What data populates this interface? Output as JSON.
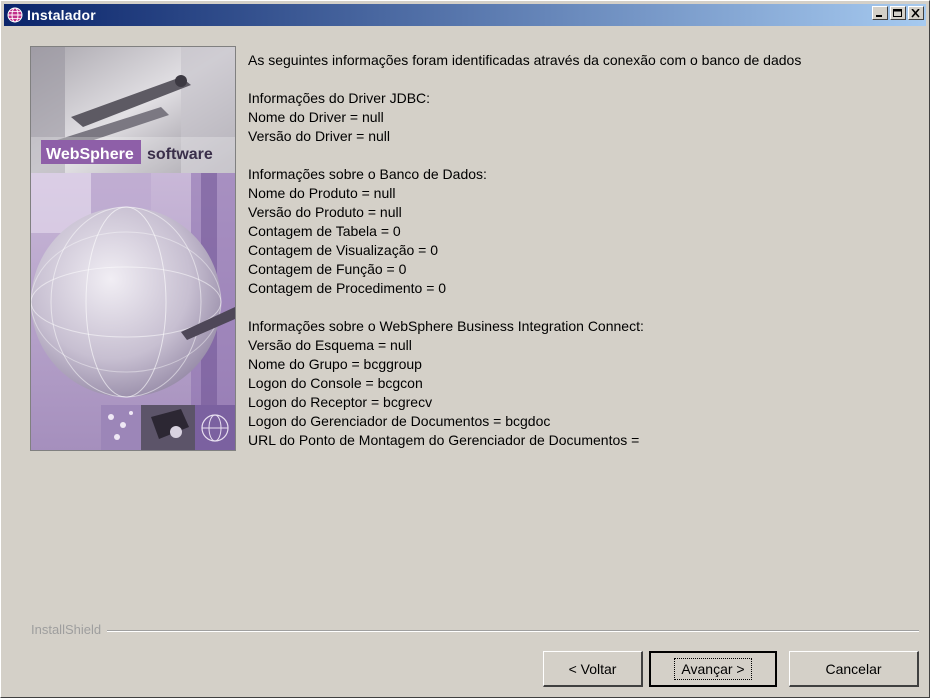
{
  "window": {
    "title": "Instalador"
  },
  "banner": {
    "brand": "WebSphere",
    "product": "software"
  },
  "content": {
    "intro": "As seguintes informações foram identificadas através da conexão com o banco de dados",
    "driver_section": {
      "heading": "Informações do Driver JDBC:",
      "lines": [
        "Nome do Driver = null",
        "Versão do Driver = null"
      ]
    },
    "db_section": {
      "heading": "Informações sobre o Banco de Dados:",
      "lines": [
        "Nome do Produto = null",
        "Versão do Produto = null",
        "Contagem de Tabela = 0",
        "Contagem de Visualização = 0",
        "Contagem de Função = 0",
        "Contagem de Procedimento = 0"
      ]
    },
    "wbi_section": {
      "heading": "Informações sobre o WebSphere Business Integration Connect:",
      "lines": [
        "Versão do Esquema = null",
        "Nome do Grupo = bcggroup",
        "Logon do Console = bcgcon",
        "Logon do Receptor = bcgrecv",
        "Logon do Gerenciador de Documentos = bcgdoc",
        "URL do Ponto de Montagem do Gerenciador de Documentos ="
      ]
    }
  },
  "footer": {
    "installshield": "InstallShield",
    "back_label": "< Voltar",
    "next_label": "Avançar >",
    "cancel_label": "Cancelar"
  }
}
